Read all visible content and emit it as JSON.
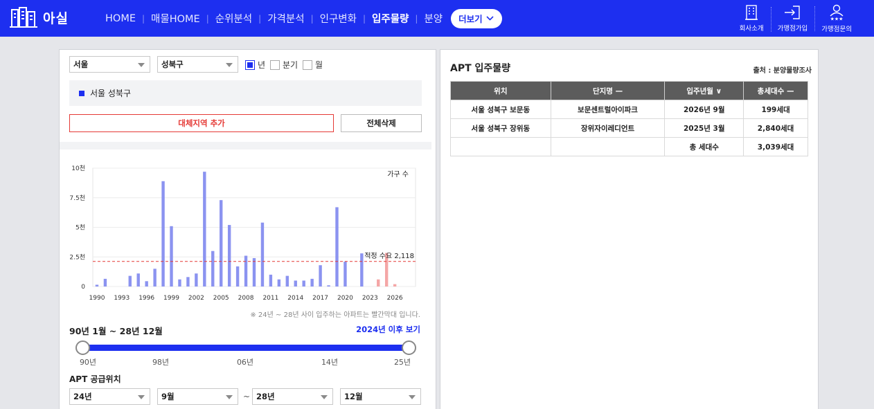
{
  "header": {
    "logo_text": "아실",
    "nav": [
      "HOME",
      "매물HOME",
      "순위분석",
      "가격분석",
      "인구변화",
      "입주물량",
      "분양"
    ],
    "active_nav_index": 5,
    "more_label": "더보기",
    "right_items": [
      {
        "label": "회사소개",
        "icon": "building-icon"
      },
      {
        "label": "가맹점가입",
        "icon": "sign-in-icon"
      },
      {
        "label": "가맹점문의",
        "icon": "person-stars-icon"
      }
    ],
    "brand_color": "#1d2ff0"
  },
  "filters": {
    "city": "서울",
    "district": "성북구",
    "period_options": [
      {
        "label": "년",
        "checked": true
      },
      {
        "label": "분기",
        "checked": false
      },
      {
        "label": "월",
        "checked": false
      }
    ]
  },
  "region_label": "서울 성북구",
  "buttons": {
    "add_region": "대체지역 추가",
    "delete_all": "전체삭제"
  },
  "chart_data": {
    "type": "bar",
    "legend": "가구 수",
    "y_ticks": [
      "0",
      "2.5천",
      "5천",
      "7.5천",
      "10천"
    ],
    "ylim": [
      0,
      10000
    ],
    "x_tick_labels": [
      "1990",
      "1993",
      "1996",
      "1999",
      "2002",
      "2005",
      "2008",
      "2011",
      "2014",
      "2017",
      "2020",
      "2023",
      "2026"
    ],
    "categories": [
      "1990",
      "1991",
      "1992",
      "1993",
      "1994",
      "1995",
      "1996",
      "1997",
      "1998",
      "1999",
      "2000",
      "2001",
      "2002",
      "2003",
      "2004",
      "2005",
      "2006",
      "2007",
      "2008",
      "2009",
      "2010",
      "2011",
      "2012",
      "2013",
      "2014",
      "2015",
      "2016",
      "2017",
      "2018",
      "2019",
      "2020",
      "2021",
      "2022",
      "2023",
      "2024",
      "2025",
      "2026",
      "2027",
      "2028"
    ],
    "values": [
      150,
      650,
      0,
      0,
      900,
      1100,
      450,
      1500,
      8900,
      5100,
      600,
      800,
      1100,
      9700,
      3000,
      7300,
      5200,
      1700,
      2600,
      2400,
      5400,
      1000,
      600,
      900,
      500,
      500,
      650,
      1800,
      100,
      6700,
      2100,
      0,
      2800,
      0,
      600,
      2840,
      199,
      0,
      0
    ],
    "future_from_index": 34,
    "normal_color": "#8b93f0",
    "future_color": "#f4a6a6",
    "reference_line": {
      "label": "적정 수요 2,118",
      "value": 2118,
      "color": "#e53935"
    }
  },
  "chart_note": "※ 24년 ~ 28년 사이 입주하는 아파트는 빨간막대 입니다.",
  "range": {
    "title": "90년 1월 ~ 28년 12월",
    "link": "2024년 이후 보기",
    "slider_min": 1990,
    "slider_max": 2028,
    "slider_from": 1990,
    "slider_to": 2028,
    "tick_labels": [
      "90년",
      "98년",
      "06년",
      "14년",
      "25년"
    ]
  },
  "supply": {
    "title": "APT 공급위치",
    "from_year": "24년",
    "from_month": "9월",
    "tilde": "~",
    "to_year": "28년",
    "to_month": "12월"
  },
  "right_panel": {
    "title": "APT 입주물량",
    "source": "출처 : 분양물량조사",
    "headers": [
      "위치",
      "단지명 —",
      "입주년월 ∨",
      "총세대수 —"
    ],
    "rows": [
      [
        "서울 성북구 보문동",
        "보문센트럴아이파크",
        "2026년 9월",
        "199세대"
      ],
      [
        "서울 성북구 장위동",
        "장위자이레디언트",
        "2025년 3월",
        "2,840세대"
      ],
      [
        "",
        "",
        "총 세대수",
        "3,039세대"
      ]
    ]
  }
}
